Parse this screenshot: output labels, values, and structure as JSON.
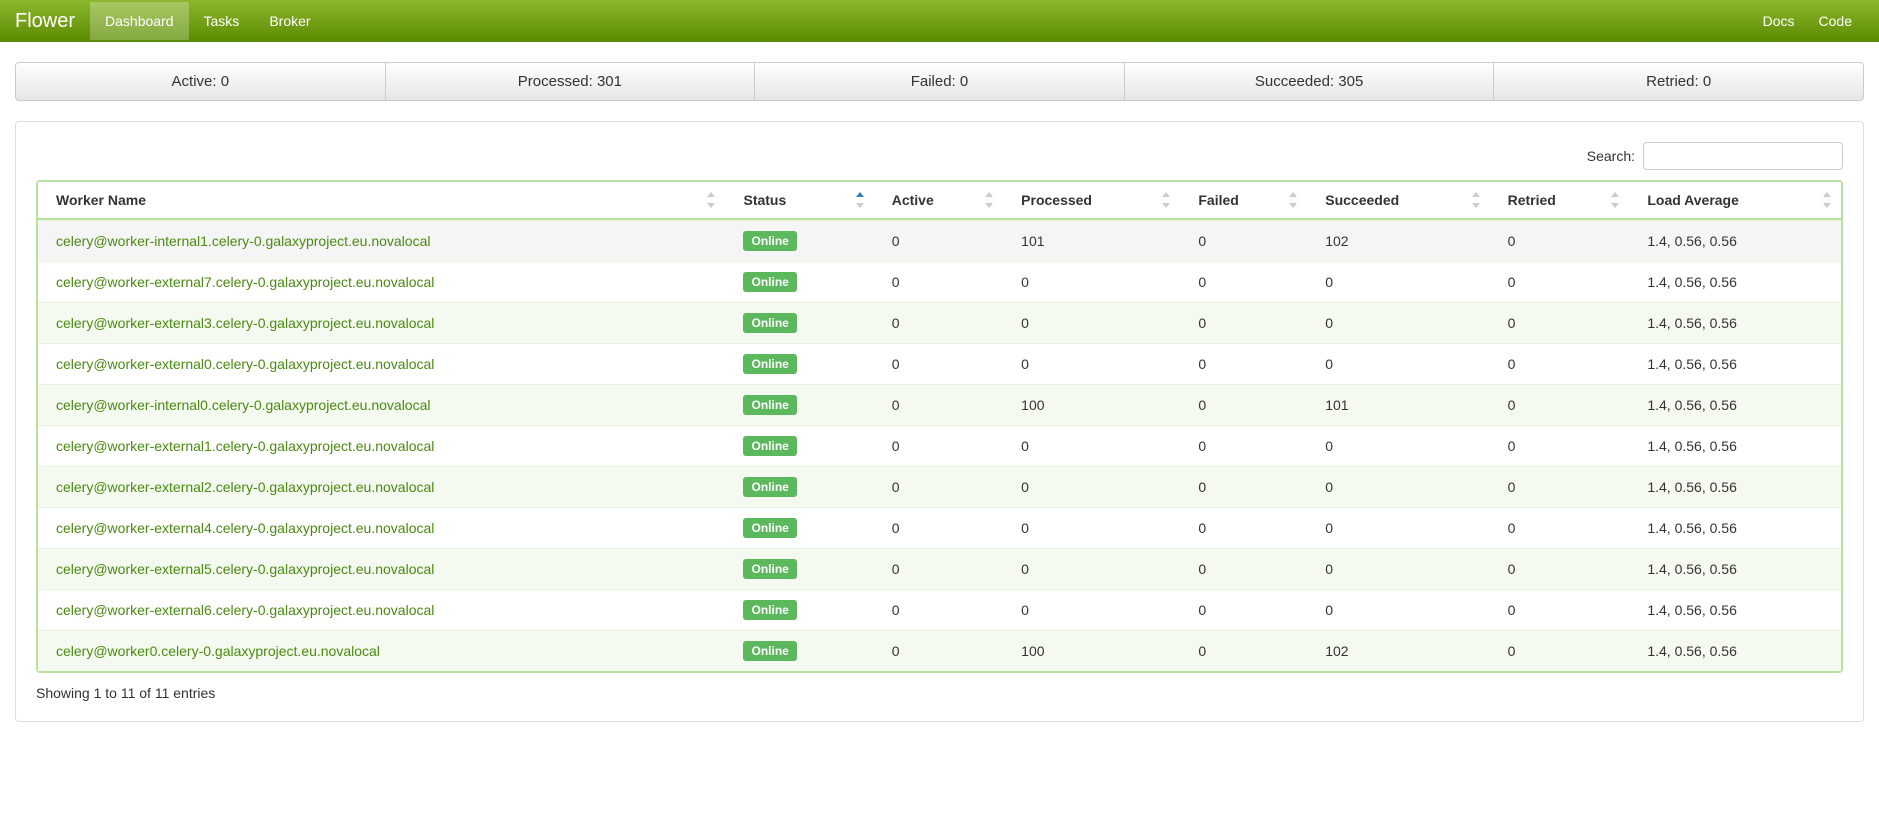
{
  "brand": "Flower",
  "nav": {
    "dashboard": "Dashboard",
    "tasks": "Tasks",
    "broker": "Broker",
    "docs": "Docs",
    "code": "Code"
  },
  "stats": {
    "active": "Active: 0",
    "processed": "Processed: 301",
    "failed": "Failed: 0",
    "succeeded": "Succeeded: 305",
    "retried": "Retried: 0"
  },
  "search": {
    "label": "Search:",
    "value": ""
  },
  "columns": {
    "worker_name": "Worker Name",
    "status": "Status",
    "active": "Active",
    "processed": "Processed",
    "failed": "Failed",
    "succeeded": "Succeeded",
    "retried": "Retried",
    "load_average": "Load Average"
  },
  "status_label": "Online",
  "workers": [
    {
      "name": "celery@worker-internal1.celery-0.galaxyproject.eu.novalocal",
      "active": "0",
      "processed": "101",
      "failed": "0",
      "succeeded": "102",
      "retried": "0",
      "load": "1.4, 0.56, 0.56"
    },
    {
      "name": "celery@worker-external7.celery-0.galaxyproject.eu.novalocal",
      "active": "0",
      "processed": "0",
      "failed": "0",
      "succeeded": "0",
      "retried": "0",
      "load": "1.4, 0.56, 0.56"
    },
    {
      "name": "celery@worker-external3.celery-0.galaxyproject.eu.novalocal",
      "active": "0",
      "processed": "0",
      "failed": "0",
      "succeeded": "0",
      "retried": "0",
      "load": "1.4, 0.56, 0.56"
    },
    {
      "name": "celery@worker-external0.celery-0.galaxyproject.eu.novalocal",
      "active": "0",
      "processed": "0",
      "failed": "0",
      "succeeded": "0",
      "retried": "0",
      "load": "1.4, 0.56, 0.56"
    },
    {
      "name": "celery@worker-internal0.celery-0.galaxyproject.eu.novalocal",
      "active": "0",
      "processed": "100",
      "failed": "0",
      "succeeded": "101",
      "retried": "0",
      "load": "1.4, 0.56, 0.56"
    },
    {
      "name": "celery@worker-external1.celery-0.galaxyproject.eu.novalocal",
      "active": "0",
      "processed": "0",
      "failed": "0",
      "succeeded": "0",
      "retried": "0",
      "load": "1.4, 0.56, 0.56"
    },
    {
      "name": "celery@worker-external2.celery-0.galaxyproject.eu.novalocal",
      "active": "0",
      "processed": "0",
      "failed": "0",
      "succeeded": "0",
      "retried": "0",
      "load": "1.4, 0.56, 0.56"
    },
    {
      "name": "celery@worker-external4.celery-0.galaxyproject.eu.novalocal",
      "active": "0",
      "processed": "0",
      "failed": "0",
      "succeeded": "0",
      "retried": "0",
      "load": "1.4, 0.56, 0.56"
    },
    {
      "name": "celery@worker-external5.celery-0.galaxyproject.eu.novalocal",
      "active": "0",
      "processed": "0",
      "failed": "0",
      "succeeded": "0",
      "retried": "0",
      "load": "1.4, 0.56, 0.56"
    },
    {
      "name": "celery@worker-external6.celery-0.galaxyproject.eu.novalocal",
      "active": "0",
      "processed": "0",
      "failed": "0",
      "succeeded": "0",
      "retried": "0",
      "load": "1.4, 0.56, 0.56"
    },
    {
      "name": "celery@worker0.celery-0.galaxyproject.eu.novalocal",
      "active": "0",
      "processed": "100",
      "failed": "0",
      "succeeded": "102",
      "retried": "0",
      "load": "1.4, 0.56, 0.56"
    }
  ],
  "table_info": "Showing 1 to 11 of 11 entries"
}
